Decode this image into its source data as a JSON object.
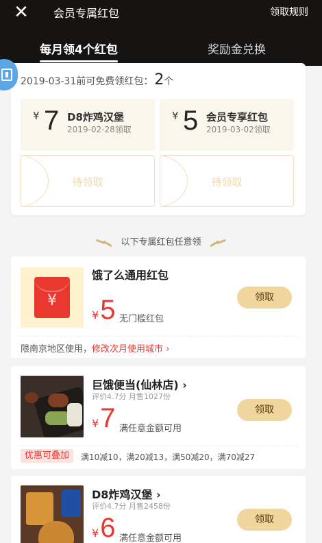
{
  "header": {
    "close_icon": "✕",
    "title": "会员专属红包",
    "rules_label": "领取规则",
    "tabs": [
      {
        "label": "每月领4个红包",
        "active": true
      },
      {
        "label": "奖励金兑换",
        "active": false
      }
    ]
  },
  "monthly": {
    "deadline_text": "2019-03-31前可免费领红包：",
    "count": "2",
    "count_unit": "个",
    "coupons": [
      {
        "currency": "¥",
        "amount": "7",
        "name": "D8炸鸡汉堡",
        "date": "2019-02-28领取"
      },
      {
        "currency": "¥",
        "amount": "5",
        "name": "会员专享红包",
        "date": "2019-03-02领取"
      }
    ],
    "pending": [
      {
        "label": "待领取"
      },
      {
        "label": "待领取"
      }
    ]
  },
  "section_divider": "以下专属红包任意领",
  "offers": [
    {
      "title": "饿了么通用红包",
      "currency": "¥",
      "amount": "5",
      "desc": "无门槛红包",
      "button": "领取",
      "note_prefix": "限南京地区使用，",
      "note_link": "修改次月使用城市 ›"
    },
    {
      "title": "巨饿便当(仙林店) ›",
      "meta": "评价4.7分   月售1027份",
      "currency": "¥",
      "amount": "7",
      "desc": "满任意金额可用",
      "button": "领取",
      "tag": "优惠可叠加",
      "promo": "满10减10，满20减13，满50减20，满70减27"
    },
    {
      "title": "D8炸鸡汉堡 ›",
      "meta": "评价4.7分   月售2458份",
      "currency": "¥",
      "amount": "6",
      "desc": "满任意金额可用",
      "button": "领取"
    }
  ],
  "colors": {
    "header_bg": "#161412",
    "accent_red": "#e8382f",
    "claim_button": "#f0d59c",
    "coupon_bg": "#fbf6ec"
  }
}
